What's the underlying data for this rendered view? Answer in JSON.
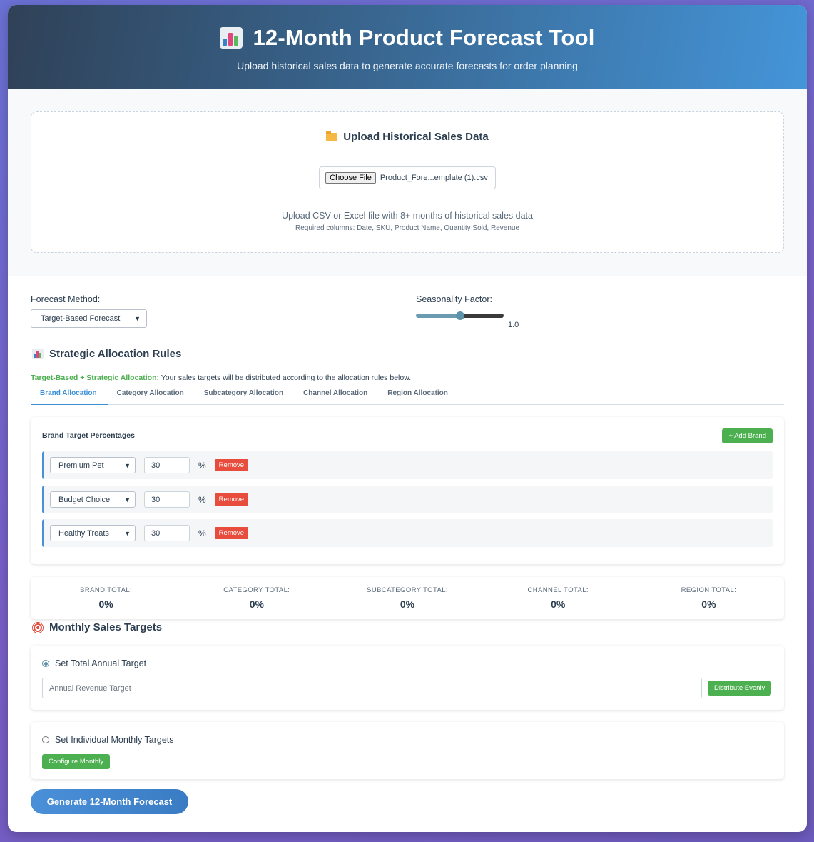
{
  "header": {
    "title": "12-Month Product Forecast Tool",
    "subtitle": "Upload historical sales data to generate accurate forecasts for order planning"
  },
  "upload": {
    "title": "Upload Historical Sales Data",
    "choose_label": "Choose File",
    "file_name": "Product_Fore...emplate (1).csv",
    "hint": "Upload CSV or Excel file with 8+ months of historical sales data",
    "required": "Required columns: Date, SKU, Product Name, Quantity Sold, Revenue"
  },
  "forecast": {
    "method_label": "Forecast Method:",
    "method_value": "Target-Based Forecast",
    "seasonality_label": "Seasonality Factor:",
    "seasonality_value": "1.0",
    "seasonality_fraction": 0.5
  },
  "strategic": {
    "title": "Strategic Allocation Rules",
    "note_bold": "Target-Based + Strategic Allocation:",
    "note_text": " Your sales targets will be distributed according to the allocation rules below.",
    "tabs": [
      {
        "label": "Brand Allocation",
        "active": true
      },
      {
        "label": "Category Allocation",
        "active": false
      },
      {
        "label": "Subcategory Allocation",
        "active": false
      },
      {
        "label": "Channel Allocation",
        "active": false
      },
      {
        "label": "Region Allocation",
        "active": false
      }
    ]
  },
  "brands": {
    "title": "Brand Target Percentages",
    "add_label": "+ Add Brand",
    "remove_label": "Remove",
    "percent_sign": "%",
    "rows": [
      {
        "brand": "Premium Pet",
        "pct": "30"
      },
      {
        "brand": "Budget Choice",
        "pct": "30"
      },
      {
        "brand": "Healthy Treats",
        "pct": "30"
      }
    ]
  },
  "totals": [
    {
      "label": "BRAND TOTAL:",
      "value": "0%"
    },
    {
      "label": "CATEGORY TOTAL:",
      "value": "0%"
    },
    {
      "label": "SUBCATEGORY TOTAL:",
      "value": "0%"
    },
    {
      "label": "CHANNEL TOTAL:",
      "value": "0%"
    },
    {
      "label": "REGION TOTAL:",
      "value": "0%"
    }
  ],
  "targets": {
    "title": "Monthly Sales Targets",
    "annual_label": "Set Total Annual Target",
    "annual_placeholder": "Annual Revenue Target",
    "distribute_label": "Distribute Evenly",
    "monthly_label": "Set Individual Monthly Targets",
    "configure_label": "Configure Monthly"
  },
  "generate_label": "Generate 12-Month Forecast",
  "colors": {
    "accent": "#4a90d9",
    "success": "#4caf50",
    "danger": "#e74c3c"
  }
}
